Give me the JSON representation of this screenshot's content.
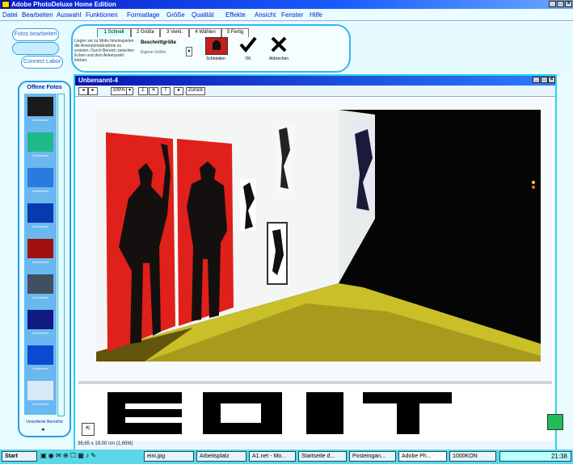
{
  "app": {
    "title": "Adobe PhotoDeluxe Home Edition",
    "window_buttons": [
      "_",
      "□",
      "×"
    ]
  },
  "menu": [
    "Datei",
    "Bearbeiten",
    "Auswahl",
    "Funktionen",
    "Formatlage",
    "Größe",
    "Qualität",
    "Effekte",
    "Ansicht",
    "Fenster",
    "Hilfe"
  ],
  "shortcuts": {
    "fotos_bearbeiten": "Fotos bearbeiten",
    "button2": "",
    "button3": "Connect Labor"
  },
  "wizard": {
    "tabs": [
      "1 Schnell",
      "2 Größe",
      "3 Verkl.",
      "4 Wählen",
      "5 Fertig"
    ],
    "description": "Liegen sie zu Motiv hineinspielen die Anstrutzmaßnahme zu erzielen. Durch Bereich zwischen Ecken und dem Ankerpunkt klicken.",
    "group_label": "Beschnittgröße",
    "group_hint": "Eigene Größe",
    "actions": [
      {
        "label": "Schneiden",
        "icon": "crop-photo-icon"
      },
      {
        "label": "OK",
        "icon": "checkmark-icon"
      },
      {
        "label": "Abbrechen",
        "icon": "cancel-x-icon"
      }
    ]
  },
  "left_panel": {
    "title": "Offene Fotos",
    "thumbnails": [
      {
        "caption": "Unbenannt",
        "color": "#1a1a1a"
      },
      {
        "caption": "Unbenannt",
        "color": "#1fb88a"
      },
      {
        "caption": "Unbenannt",
        "color": "#2a7ae0"
      },
      {
        "caption": "Unbenannt",
        "color": "#0a3ab0"
      },
      {
        "caption": "Unbenannt",
        "color": "#a01010"
      },
      {
        "caption": "Unbenannt",
        "color": "#405060"
      },
      {
        "caption": "Unbenannt",
        "color": "#101a80"
      },
      {
        "caption": "Unbenannt",
        "color": "#0a4ad0"
      },
      {
        "caption": "Unbenannt",
        "color": "#d8e8f8"
      }
    ],
    "footer": "Unsortierte Bereiche"
  },
  "document": {
    "title": "Unbenannt-4",
    "zoom": "100%",
    "toolbar_items": [
      "◂",
      "▸",
      "100%",
      "▾",
      "Σ",
      "✕",
      "T",
      "●",
      "Zurück"
    ],
    "status": "36,65 x 19,00 cm (1,65M)"
  },
  "overlay_text": "EDIT",
  "taskbar": {
    "start": "Start",
    "items": [
      "eini.jpg",
      "Arbeitsplatz",
      "A1.net - Mo...",
      "Startseite d...",
      "Posteingan...",
      "Adobe Ph...",
      "1000KON"
    ],
    "clock": "21:38"
  },
  "colors": {
    "accent": "#2aa0e0",
    "title_bar": "#0a1cc8",
    "poster_red": "#e0201a",
    "floor_yellow": "#c8c020"
  }
}
